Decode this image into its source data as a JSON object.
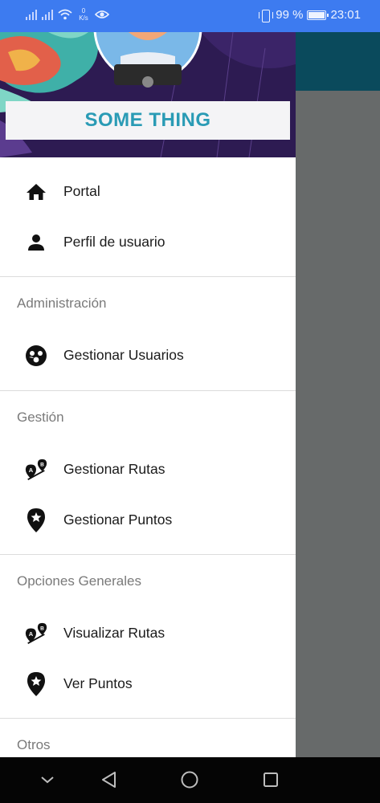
{
  "status_bar": {
    "speed_value": "0",
    "speed_unit": "K/s",
    "battery_text": "99 %",
    "time": "23:01",
    "icons": [
      "signal-icon",
      "signal-icon",
      "wifi-icon",
      "eye-icon",
      "vibrate-icon",
      "battery-icon"
    ],
    "battery_level": 0.99
  },
  "drawer": {
    "brand_title": "SOME THING",
    "primary_items": [
      {
        "label": "Portal",
        "icon": "home-icon"
      },
      {
        "label": "Perfil de usuario",
        "icon": "person-icon"
      }
    ],
    "sections": [
      {
        "title": "Administración",
        "items": [
          {
            "label": "Gestionar Usuarios",
            "icon": "users-group-icon"
          }
        ]
      },
      {
        "title": "Gestión",
        "items": [
          {
            "label": "Gestionar Rutas",
            "icon": "route-icon"
          },
          {
            "label": "Gestionar Puntos",
            "icon": "star-pin-icon"
          }
        ]
      },
      {
        "title": "Opciones Generales",
        "items": [
          {
            "label": "Visualizar Rutas",
            "icon": "route-icon"
          },
          {
            "label": "Ver Puntos",
            "icon": "star-pin-icon"
          }
        ]
      },
      {
        "title": "Otros",
        "items": []
      }
    ]
  },
  "colors": {
    "status_bar": "#3d7bf0",
    "app_bar": "#0a4a5c",
    "brand_text": "#2a9bb5",
    "scrim": "#676a6a",
    "nav_bar": "#050505"
  },
  "nav_bar": {
    "buttons": [
      "chevron-down-icon",
      "back-icon",
      "home-circle-icon",
      "recents-icon"
    ]
  }
}
